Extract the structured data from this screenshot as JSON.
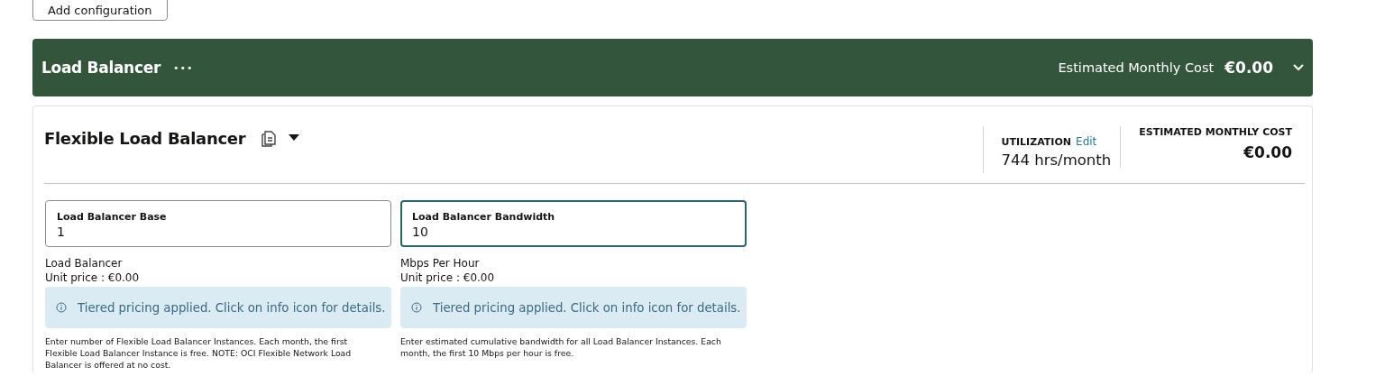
{
  "toolbar": {
    "add_button": "Add configuration"
  },
  "section": {
    "title": "Load Balancer",
    "more": "•••",
    "cost_label": "Estimated Monthly Cost",
    "cost_value": "€0.00",
    "expanded": true
  },
  "card": {
    "title": "Flexible Load Balancer",
    "utilization_label": "UTILIZATION",
    "utilization_edit": "Edit",
    "utilization_value": "744 hrs/month",
    "cost_label": "ESTIMATED MONTHLY COST",
    "cost_value": "€0.00",
    "fields": [
      {
        "label": "Load Balancer Base",
        "value": "1",
        "focused": false,
        "unit": "Load Balancer",
        "unit_price": "Unit price :  €0.00",
        "notice": "Tiered pricing applied. Click on info icon for details.",
        "help": "Enter number of Flexible Load Balancer Instances. Each month, the first Flexible Load Balancer Instance is free. NOTE: OCI Flexible Network Load Balancer is offered at no cost."
      },
      {
        "label": "Load Balancer Bandwidth",
        "value": "10",
        "focused": true,
        "unit": "Mbps Per Hour",
        "unit_price": "Unit price :  €0.00",
        "notice": "Tiered pricing applied. Click on info icon for details.",
        "help": "Enter estimated cumulative bandwidth for all Load Balancer Instances. Each month, the first 10 Mbps per hour is free."
      }
    ]
  }
}
